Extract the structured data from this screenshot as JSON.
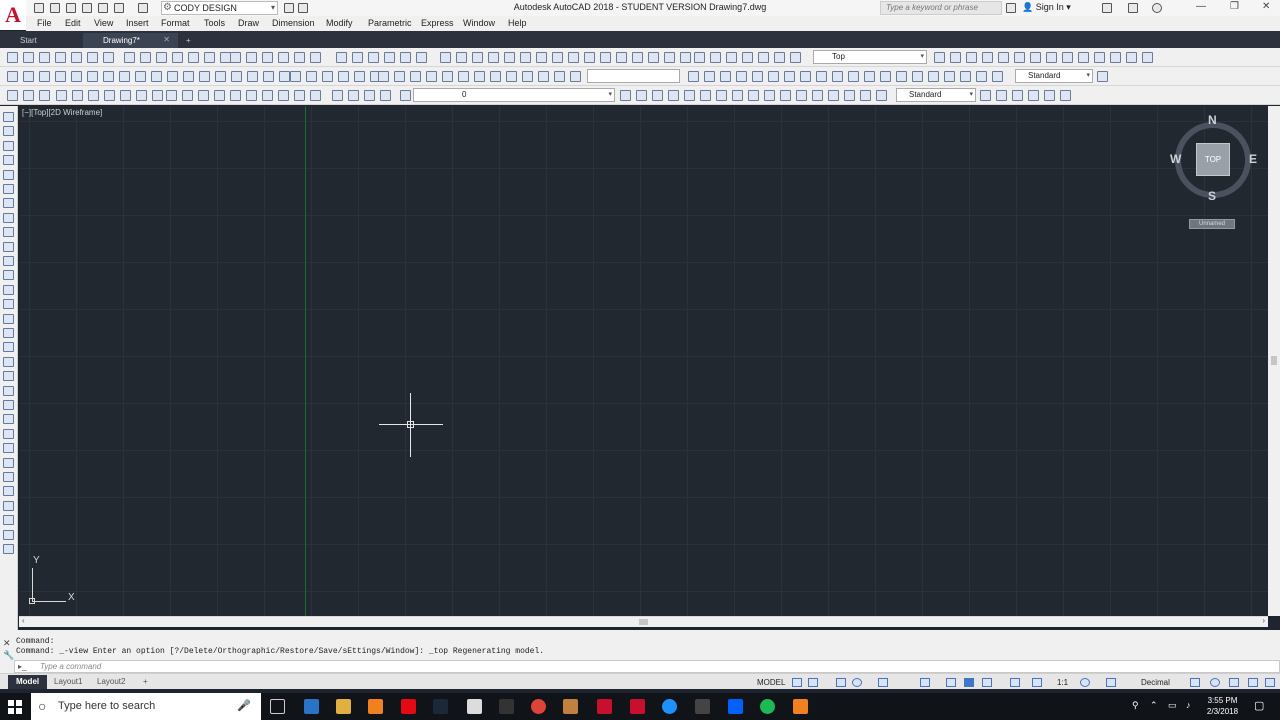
{
  "title_bar": {
    "workspace": "CODY DESIGN",
    "window_title": "Autodesk AutoCAD 2018 - STUDENT VERSION    Drawing7.dwg",
    "search_placeholder": "Type a keyword or phrase",
    "sign_in": "Sign In"
  },
  "menu": [
    "File",
    "Edit",
    "View",
    "Insert",
    "Format",
    "Tools",
    "Draw",
    "Dimension",
    "Modify",
    "Parametric",
    "Express",
    "Window",
    "Help"
  ],
  "doc_tabs": {
    "start": "Start",
    "drawing": "Drawing7*",
    "new": "+"
  },
  "toolbars": {
    "view_select": "Top",
    "text_style": "Standard",
    "layer_name": "0",
    "dim_style": "Standard"
  },
  "viewport": {
    "label": "[−][Top][2D Wireframe]",
    "ucs_x": "X",
    "ucs_y": "Y"
  },
  "viewcube": {
    "north": "N",
    "south": "S",
    "east": "E",
    "west": "W",
    "face": "TOP",
    "ucs_name": "Unnamed"
  },
  "command": {
    "line1": "Command:",
    "line2": "Command: _-view Enter an option [?/Delete/Orthographic/Restore/Save/sEttings/Window]: _top Regenerating model.",
    "placeholder": "Type a command"
  },
  "layout_tabs": [
    "Model",
    "Layout1",
    "Layout2"
  ],
  "status": {
    "mode": "MODEL",
    "scale": "1:1",
    "units": "Decimal"
  },
  "taskbar": {
    "search": "Type here to search",
    "time": "3:55 PM",
    "date": "2/3/2018"
  }
}
